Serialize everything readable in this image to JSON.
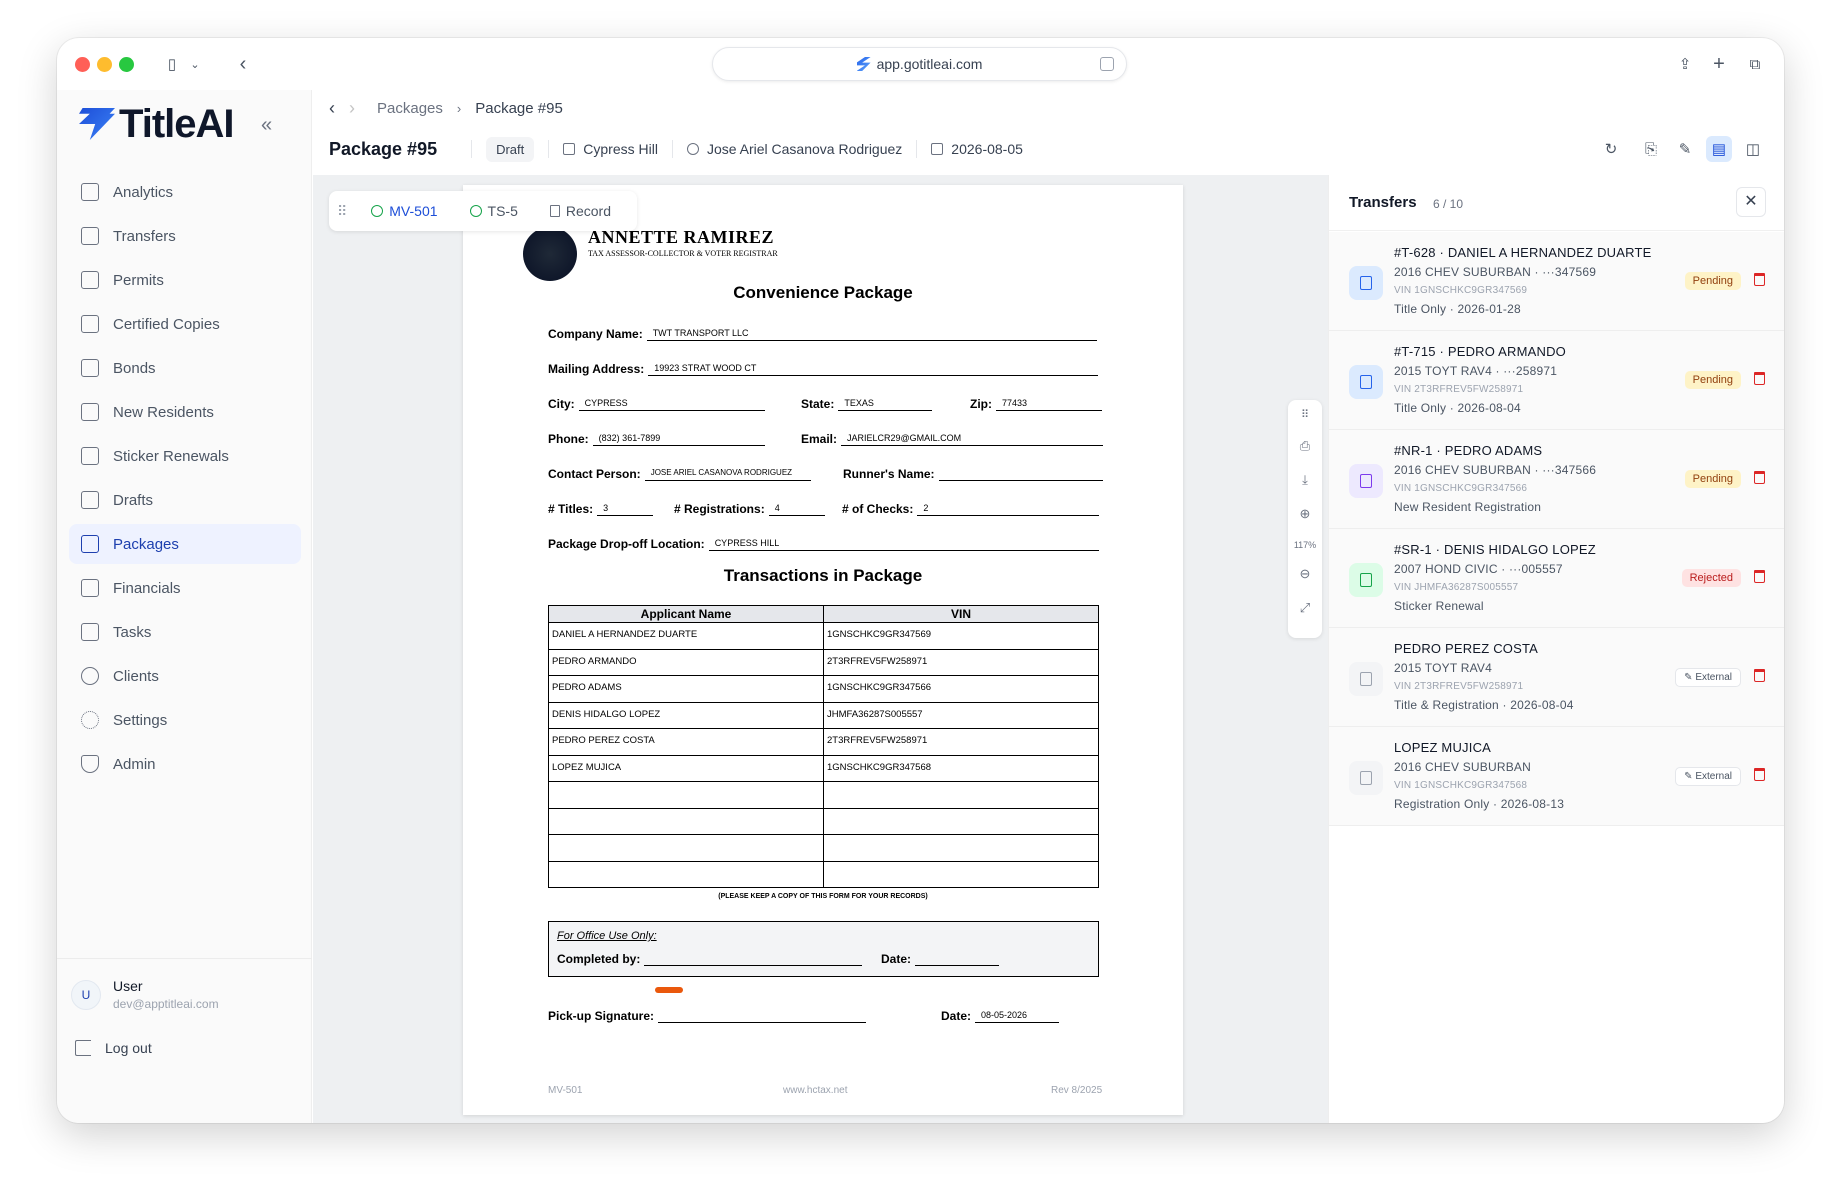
{
  "browser": {
    "url": "app.gotitleai.com"
  },
  "sidebar": {
    "logo_text": "TitleAI",
    "collapse_icon": "«",
    "items": [
      {
        "label": "Analytics",
        "icon": "chart-doc-icon"
      },
      {
        "label": "Transfers",
        "icon": "transfer-doc-icon"
      },
      {
        "label": "Permits",
        "icon": "permit-doc-icon"
      },
      {
        "label": "Certified Copies",
        "icon": "copies-icon"
      },
      {
        "label": "Bonds",
        "icon": "bond-doc-icon"
      },
      {
        "label": "New Residents",
        "icon": "resident-doc-icon"
      },
      {
        "label": "Sticker Renewals",
        "icon": "sticker-doc-icon"
      },
      {
        "label": "Drafts",
        "icon": "draft-doc-icon"
      },
      {
        "label": "Packages",
        "icon": "package-doc-icon",
        "active": true
      },
      {
        "label": "Financials",
        "icon": "bank-icon"
      },
      {
        "label": "Tasks",
        "icon": "clipboard-icon"
      },
      {
        "label": "Clients",
        "icon": "users-icon"
      },
      {
        "label": "Settings",
        "icon": "gear-icon"
      },
      {
        "label": "Admin",
        "icon": "shield-icon"
      }
    ],
    "user": {
      "initial": "U",
      "name": "User",
      "email": "dev@apptitleai.com"
    },
    "logout_label": "Log out"
  },
  "breadcrumb": {
    "parent": "Packages",
    "current": "Package #95"
  },
  "header": {
    "title": "Package #95",
    "status": "Draft",
    "location": "Cypress Hill",
    "person": "Jose Ariel Casanova Rodriguez",
    "date": "2026-08-05"
  },
  "doc_tabs": [
    {
      "label": "MV-501",
      "state": "done"
    },
    {
      "label": "TS-5",
      "state": "done"
    },
    {
      "label": "Record",
      "state": "doc"
    }
  ],
  "document": {
    "assessor_name": "ANNETTE RAMIREZ",
    "assessor_title": "TAX ASSESSOR-COLLECTOR & VOTER REGISTRAR",
    "title": "Convenience Package",
    "fields": {
      "company_label": "Company Name:",
      "company": "TWT TRANSPORT LLC",
      "mailing_label": "Mailing Address:",
      "mailing": "19923 STRAT WOOD CT",
      "city_label": "City:",
      "city": "CYPRESS",
      "state_label": "State:",
      "state": "TEXAS",
      "zip_label": "Zip:",
      "zip": "77433",
      "phone_label": "Phone:",
      "phone": "(832) 361-7899",
      "email_label": "Email:",
      "email": "JARIELCR29@GMAIL.COM",
      "contact_label": "Contact Person:",
      "contact": "JOSE ARIEL CASANOVA RODRIGUEZ",
      "runner_label": "Runner's Name:",
      "runner": "",
      "titles_label": "# Titles:",
      "titles": "3",
      "registrations_label": "# Registrations:",
      "registrations": "4",
      "checks_label": "# of Checks:",
      "checks": "2",
      "dropoff_label": "Package Drop-off Location:",
      "dropoff": "CYPRESS HILL"
    },
    "transactions_title": "Transactions in Package",
    "table_headers": [
      "Applicant Name",
      "VIN"
    ],
    "rows": [
      [
        "DANIEL A HERNANDEZ DUARTE",
        "1GNSCHKC9GR347569"
      ],
      [
        "PEDRO ARMANDO",
        "2T3RFREV5FW258971"
      ],
      [
        "PEDRO ADAMS",
        "1GNSCHKC9GR347566"
      ],
      [
        "DENIS HIDALGO LOPEZ",
        "JHMFA36287S005557"
      ],
      [
        "PEDRO PEREZ COSTA",
        "2T3RFREV5FW258971"
      ],
      [
        "LOPEZ MUJICA",
        "1GNSCHKC9GR347568"
      ],
      [
        "",
        ""
      ],
      [
        "",
        ""
      ],
      [
        "",
        ""
      ],
      [
        "",
        ""
      ]
    ],
    "keep_note": "(PLEASE KEEP A COPY OF THIS FORM FOR YOUR RECORDS)",
    "office_label": "For Office Use Only:",
    "completed_label": "Completed by:",
    "date_label": "Date:",
    "pickup_label": "Pick-up Signature:",
    "pickup_date": "08-05-2026",
    "footer_left": "MV-501",
    "footer_center": "www.hctax.net",
    "footer_right": "Rev 8/2025"
  },
  "zoom": {
    "level": "117%"
  },
  "transfers": {
    "title": "Transfers",
    "count": "6 / 10",
    "items": [
      {
        "title": "#T-628 · DANIEL A HERNANDEZ DUARTE",
        "vehicle": "2016 CHEV SUBURBAN · ···347569",
        "vin": "VIN 1GNSCHKC9GR347569",
        "type": "Title Only · 2026-01-28",
        "status": "Pending",
        "color": "#2563eb"
      },
      {
        "title": "#T-715 · PEDRO ARMANDO",
        "vehicle": "2015 TOYT RAV4 · ···258971",
        "vin": "VIN 2T3RFREV5FW258971",
        "type": "Title Only · 2026-08-04",
        "status": "Pending",
        "color": "#2563eb"
      },
      {
        "title": "#NR-1 · PEDRO ADAMS",
        "vehicle": "2016 CHEV SUBURBAN · ···347566",
        "vin": "VIN 1GNSCHKC9GR347566",
        "type": "New Resident Registration",
        "status": "Pending",
        "color": "#7c3aed"
      },
      {
        "title": "#SR-1 · DENIS HIDALGO LOPEZ",
        "vehicle": "2007 HOND CIVIC · ···005557",
        "vin": "VIN JHMFA36287S005557",
        "type": "Sticker Renewal",
        "status": "Rejected",
        "color": "#16a34a"
      },
      {
        "title": "PEDRO PEREZ COSTA",
        "vehicle": "2015 TOYT RAV4",
        "vin": "VIN 2T3RFREV5FW258971",
        "type": "Title & Registration · 2026-08-04",
        "status": "External",
        "color": "#9ca3af"
      },
      {
        "title": "LOPEZ MUJICA",
        "vehicle": "2016 CHEV SUBURBAN",
        "vin": "VIN 1GNSCHKC9GR347568",
        "type": "Registration Only · 2026-08-13",
        "status": "External",
        "color": "#9ca3af"
      }
    ]
  }
}
